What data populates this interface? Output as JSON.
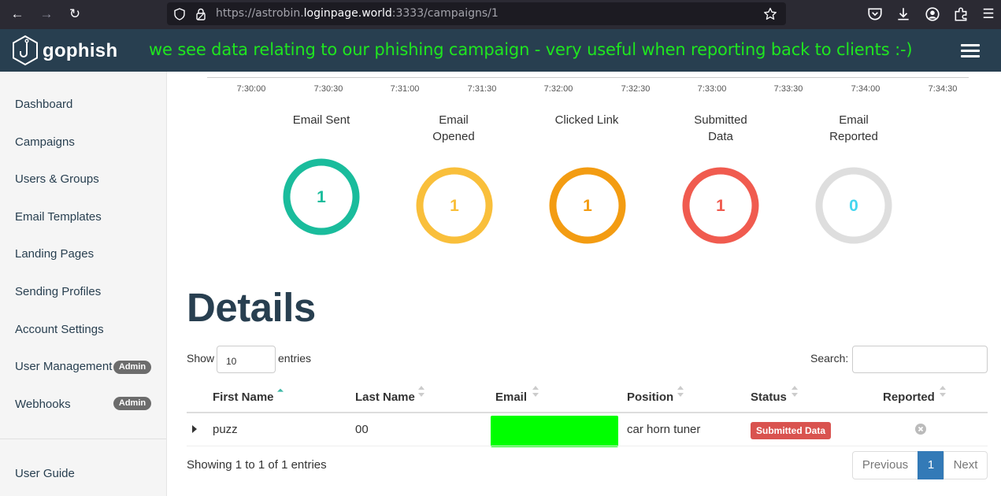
{
  "browser": {
    "url_prefix": "https://astrobin.",
    "url_host": "loginpage.world",
    "url_suffix": ":3333/campaigns/1"
  },
  "header": {
    "logo_text": "gophish",
    "annotation": "we see data relating to our phishing campaign - very useful when reporting back to clients :-)"
  },
  "sidebar": {
    "items": [
      {
        "label": "Dashboard"
      },
      {
        "label": "Campaigns"
      },
      {
        "label": "Users & Groups"
      },
      {
        "label": "Email Templates"
      },
      {
        "label": "Landing Pages"
      },
      {
        "label": "Sending Profiles"
      },
      {
        "label": "Account Settings"
      },
      {
        "label": "User Management",
        "badge": "Admin"
      },
      {
        "label": "Webhooks",
        "badge": "Admin"
      }
    ],
    "footer_item": "User Guide"
  },
  "timeline": {
    "ticks": [
      "7:30:00",
      "7:30:30",
      "7:31:00",
      "7:31:30",
      "7:32:00",
      "7:32:30",
      "7:33:00",
      "7:33:30",
      "7:34:00",
      "7:34:30"
    ]
  },
  "stats": [
    {
      "label": "Email Sent",
      "value": "1",
      "color": "#1abc9c"
    },
    {
      "label": "Email Opened",
      "value": "1",
      "color": "#f9bf3b"
    },
    {
      "label": "Clicked Link",
      "value": "1",
      "color": "#f39c12"
    },
    {
      "label": "Submitted Data",
      "value": "1",
      "color": "#f05b4f"
    },
    {
      "label": "Email Reported",
      "value": "0",
      "color": "#45d6ef"
    }
  ],
  "details": {
    "title": "Details",
    "show_label": "Show",
    "entries_value": "10",
    "entries_label": "entries",
    "search_label": "Search:",
    "columns": [
      "First Name",
      "Last Name",
      "Email",
      "Position",
      "Status",
      "Reported"
    ],
    "rows": [
      {
        "first_name": "puzz",
        "last_name": "00",
        "position": "car horn tuner",
        "status": "Submitted Data"
      }
    ],
    "info": "Showing 1 to 1 of 1 entries",
    "pager": {
      "previous": "Previous",
      "current": "1",
      "next": "Next"
    }
  }
}
